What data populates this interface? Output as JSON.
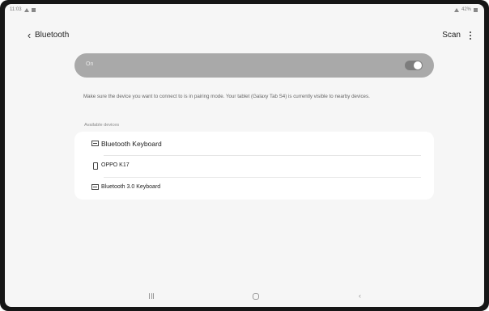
{
  "status_bar": {
    "time": "11:03",
    "battery": "42%",
    "left_icons": [
      "alert-icon",
      "notification-icon"
    ],
    "right_icons": [
      "wifi-icon",
      "battery-icon"
    ]
  },
  "header": {
    "title": "Bluetooth",
    "scan_label": "Scan",
    "back_icon": "chevron-left-icon",
    "more_icon": "more-vertical-icon"
  },
  "toggle": {
    "label": "On",
    "state": true
  },
  "description": "Make sure the device you want to connect to is in pairing mode. Your tablet (Galaxy Tab S4) is currently visible to nearby devices.",
  "available_devices": {
    "header": "Available devices",
    "items": [
      {
        "name": "Bluetooth Keyboard",
        "icon": "keyboard-icon"
      },
      {
        "name": "OPPO K17",
        "icon": "phone-icon"
      },
      {
        "name": "Bluetooth 3.0 Keyboard",
        "icon": "keyboard-icon"
      }
    ]
  },
  "nav_bar": {
    "icons": [
      "recents-icon",
      "home-icon",
      "back-icon"
    ]
  },
  "colors": {
    "toggle_card": "#a9a9a9",
    "background": "#f6f6f6",
    "card": "#ffffff"
  }
}
